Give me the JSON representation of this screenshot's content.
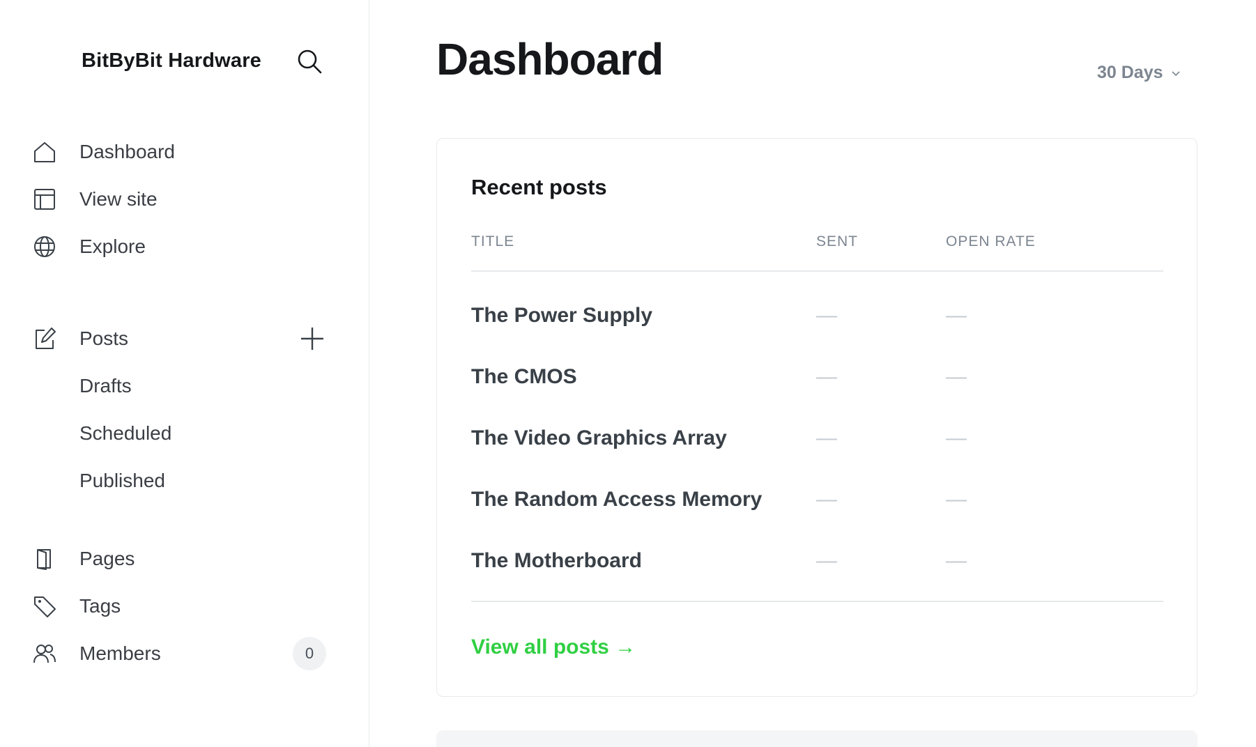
{
  "sidebar": {
    "brand": "BitByBit Hardware",
    "search_icon": "search-icon",
    "nav": [
      {
        "label": "Dashboard",
        "icon": "home-icon"
      },
      {
        "label": "View site",
        "icon": "layout-icon"
      },
      {
        "label": "Explore",
        "icon": "globe-icon"
      }
    ],
    "posts": {
      "label": "Posts",
      "icon": "edit-icon",
      "add_icon": "plus-icon",
      "sub": [
        "Drafts",
        "Scheduled",
        "Published"
      ]
    },
    "more": [
      {
        "label": "Pages",
        "icon": "pages-icon"
      },
      {
        "label": "Tags",
        "icon": "tag-icon"
      },
      {
        "label": "Members",
        "icon": "members-icon",
        "badge": "0"
      }
    ]
  },
  "main": {
    "title": "Dashboard",
    "range": "30 Days",
    "recent_posts": {
      "heading": "Recent posts",
      "columns": [
        "TITLE",
        "SENT",
        "OPEN RATE"
      ],
      "rows": [
        {
          "title": "The Power Supply",
          "sent": "—",
          "open_rate": "—"
        },
        {
          "title": "The CMOS",
          "sent": "—",
          "open_rate": "—"
        },
        {
          "title": "The Video Graphics Array",
          "sent": "—",
          "open_rate": "—"
        },
        {
          "title": "The Random Access Memory",
          "sent": "—",
          "open_rate": "—"
        },
        {
          "title": "The Motherboard",
          "sent": "—",
          "open_rate": "—"
        }
      ],
      "view_all": "View all posts →"
    }
  },
  "colors": {
    "accent": "#30cf43",
    "text": "#15171a",
    "muted": "#7c8590",
    "border": "#e6e9eb"
  }
}
